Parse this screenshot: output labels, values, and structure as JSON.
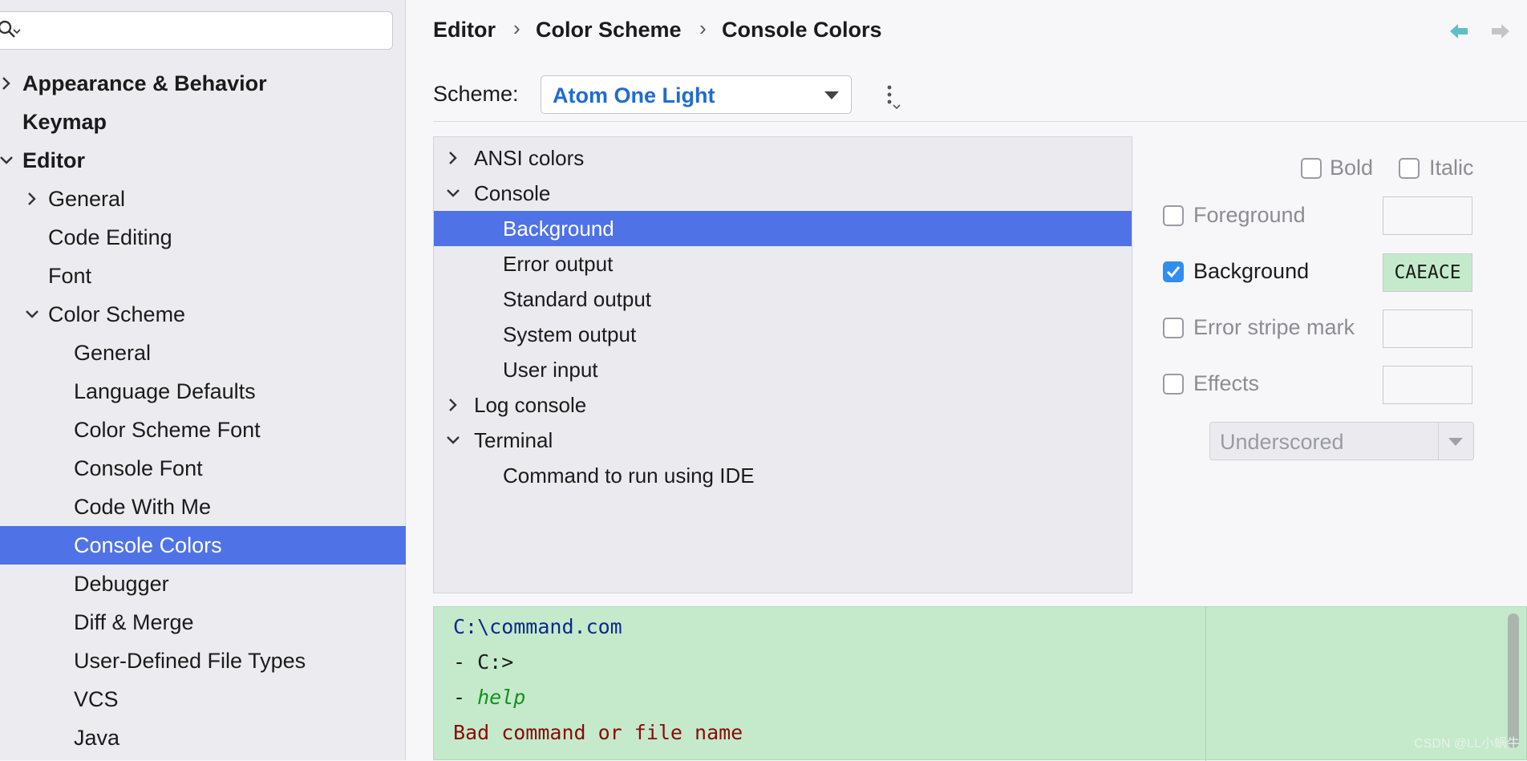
{
  "sidebar": {
    "search": {
      "placeholder": "",
      "value": ""
    },
    "items": [
      {
        "label": "Appearance & Behavior",
        "level": 0,
        "bold": true,
        "chevron": "right"
      },
      {
        "label": "Keymap",
        "level": 0,
        "bold": true,
        "chevron": null
      },
      {
        "label": "Editor",
        "level": 0,
        "bold": true,
        "chevron": "down"
      },
      {
        "label": "General",
        "level": 1,
        "bold": false,
        "chevron": "right"
      },
      {
        "label": "Code Editing",
        "level": 1,
        "bold": false,
        "chevron": null
      },
      {
        "label": "Font",
        "level": 1,
        "bold": false,
        "chevron": null
      },
      {
        "label": "Color Scheme",
        "level": 1,
        "bold": false,
        "chevron": "down"
      },
      {
        "label": "General",
        "level": 2,
        "bold": false,
        "chevron": null
      },
      {
        "label": "Language Defaults",
        "level": 2,
        "bold": false,
        "chevron": null
      },
      {
        "label": "Color Scheme Font",
        "level": 2,
        "bold": false,
        "chevron": null
      },
      {
        "label": "Console Font",
        "level": 2,
        "bold": false,
        "chevron": null
      },
      {
        "label": "Code With Me",
        "level": 2,
        "bold": false,
        "chevron": null
      },
      {
        "label": "Console Colors",
        "level": 2,
        "bold": false,
        "chevron": null,
        "selected": true
      },
      {
        "label": "Debugger",
        "level": 2,
        "bold": false,
        "chevron": null
      },
      {
        "label": "Diff & Merge",
        "level": 2,
        "bold": false,
        "chevron": null
      },
      {
        "label": "User-Defined File Types",
        "level": 2,
        "bold": false,
        "chevron": null
      },
      {
        "label": "VCS",
        "level": 2,
        "bold": false,
        "chevron": null
      },
      {
        "label": "Java",
        "level": 2,
        "bold": false,
        "chevron": null
      }
    ]
  },
  "breadcrumb": [
    "Editor",
    "Color Scheme",
    "Console Colors"
  ],
  "breadcrumb_separator": "›",
  "scheme": {
    "label": "Scheme:",
    "value": "Atom One Light"
  },
  "tree": [
    {
      "label": "ANSI colors",
      "level": 0,
      "chevron": "right"
    },
    {
      "label": "Console",
      "level": 0,
      "chevron": "down"
    },
    {
      "label": "Background",
      "level": 1,
      "chevron": null,
      "selected": true
    },
    {
      "label": "Error output",
      "level": 1,
      "chevron": null
    },
    {
      "label": "Standard output",
      "level": 1,
      "chevron": null
    },
    {
      "label": "System output",
      "level": 1,
      "chevron": null
    },
    {
      "label": "User input",
      "level": 1,
      "chevron": null
    },
    {
      "label": "Log console",
      "level": 0,
      "chevron": "right"
    },
    {
      "label": "Terminal",
      "level": 0,
      "chevron": "down"
    },
    {
      "label": "Command to run using IDE",
      "level": 1,
      "chevron": null
    }
  ],
  "options": {
    "bold": {
      "label": "Bold",
      "checked": false
    },
    "italic": {
      "label": "Italic",
      "checked": false
    },
    "foreground": {
      "label": "Foreground",
      "checked": false,
      "color": ""
    },
    "background": {
      "label": "Background",
      "checked": true,
      "color": "CAEACE"
    },
    "error_stripe": {
      "label": "Error stripe mark",
      "checked": false,
      "color": ""
    },
    "effects": {
      "label": "Effects",
      "checked": false,
      "color": "",
      "style": "Underscored"
    }
  },
  "preview": {
    "lines": [
      {
        "text": "C:\\command.com",
        "color": "#0d2a8a",
        "italic": false
      },
      {
        "text": "- C:>",
        "color": "#1b1b1b",
        "italic": false
      },
      {
        "prefix": "- ",
        "text": "help",
        "color": "#14901e",
        "italic": true
      },
      {
        "text": "Bad command or file name",
        "color": "#8a0a0a",
        "italic": false
      }
    ],
    "background": "#c4eacb"
  },
  "watermark": "CSDN @LL小蜗牛",
  "colors": {
    "accent": "#4f73e6",
    "scheme_value": "#1f6bd4",
    "checkbox": "#2f8ef3",
    "nav_arrow": "#5ec0c6"
  }
}
